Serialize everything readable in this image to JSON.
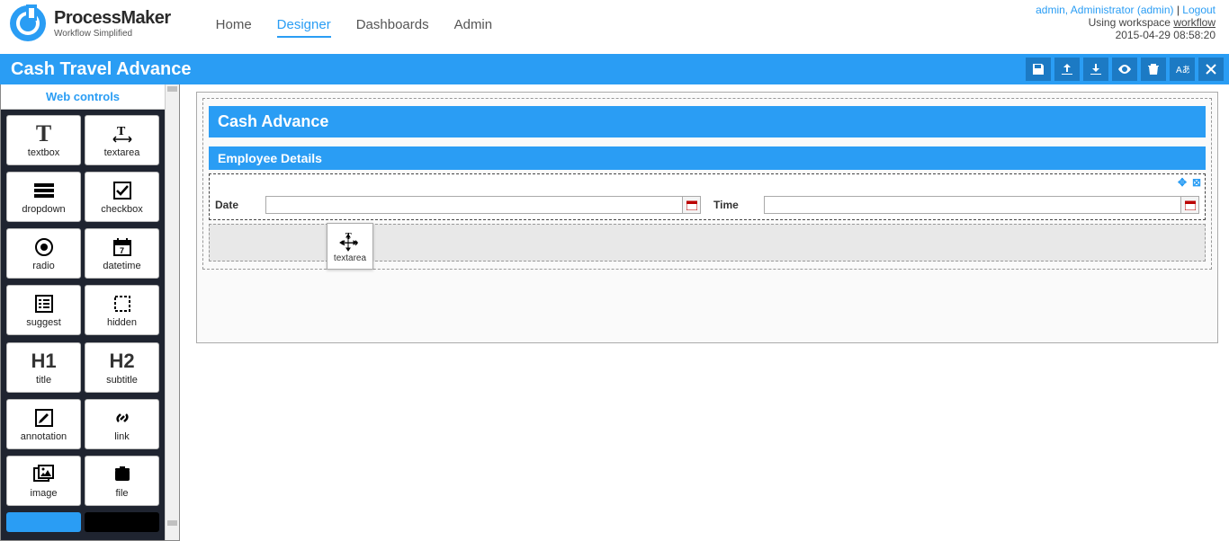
{
  "app": {
    "name": "ProcessMaker",
    "tagline": "Workflow Simplified"
  },
  "nav": {
    "home": "Home",
    "designer": "Designer",
    "dashboards": "Dashboards",
    "admin": "Admin"
  },
  "user": {
    "label": "admin, Administrator (admin)",
    "logout": "Logout",
    "workspace_prefix": "Using workspace ",
    "workspace": "workflow",
    "timestamp": "2015-04-29 08:58:20"
  },
  "titlebar": {
    "title": "Cash Travel Advance"
  },
  "sidebar": {
    "header": "Web controls",
    "items": [
      {
        "label": "textbox",
        "icon": "T"
      },
      {
        "label": "textarea",
        "icon": "textarea"
      },
      {
        "label": "dropdown",
        "icon": "menu"
      },
      {
        "label": "checkbox",
        "icon": "check"
      },
      {
        "label": "radio",
        "icon": "radio"
      },
      {
        "label": "datetime",
        "icon": "calendar"
      },
      {
        "label": "suggest",
        "icon": "list"
      },
      {
        "label": "hidden",
        "icon": "dashed"
      },
      {
        "label": "title",
        "icon": "H1"
      },
      {
        "label": "subtitle",
        "icon": "H2"
      },
      {
        "label": "annotation",
        "icon": "edit"
      },
      {
        "label": "link",
        "icon": "link"
      },
      {
        "label": "image",
        "icon": "image"
      },
      {
        "label": "file",
        "icon": "file"
      }
    ]
  },
  "form": {
    "title": "Cash Advance",
    "subtitle": "Employee Details",
    "fields": {
      "date_label": "Date",
      "time_label": "Time"
    },
    "drag_label": "textarea"
  }
}
